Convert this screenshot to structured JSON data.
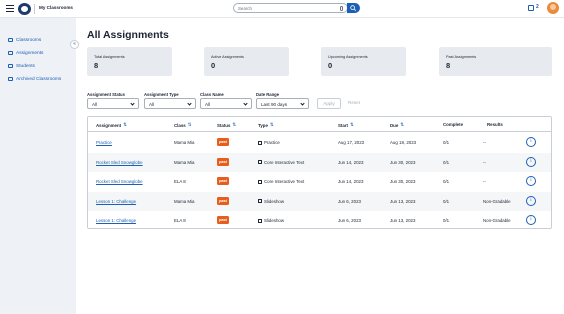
{
  "topbar": {
    "app_title": "My Classrooms",
    "search_placeholder": "Search",
    "notification_count": "2"
  },
  "sidebar": {
    "collapse_glyph": "«",
    "items": [
      {
        "label": "Classrooms"
      },
      {
        "label": "Assignments"
      },
      {
        "label": "Students"
      },
      {
        "label": "Archived Classrooms"
      }
    ]
  },
  "main": {
    "title": "All Assignments",
    "stats": [
      {
        "label": "Total Assignments",
        "value": "8"
      },
      {
        "label": "Active Assignments",
        "value": "0"
      },
      {
        "label": "Upcoming Assignments",
        "value": "0"
      },
      {
        "label": "Past Assignments",
        "value": "8"
      }
    ],
    "filters": {
      "status": {
        "label": "Assignment Status",
        "value": "All"
      },
      "type": {
        "label": "Assignment Type",
        "value": "All"
      },
      "class": {
        "label": "Class Name",
        "value": "All"
      },
      "date": {
        "label": "Date Range",
        "value": "Last 90 days"
      },
      "apply_label": "Apply",
      "reset_label": "Reset"
    },
    "table": {
      "headers": {
        "assignment": "Assignment",
        "class": "Class",
        "status": "Status",
        "type": "Type",
        "start": "Start",
        "due": "Due",
        "complete": "Complete",
        "results": "Results"
      },
      "sort_glyph": "⇅",
      "info_glyph": "i",
      "rows": [
        {
          "assignment": "Practice",
          "class": "Mama Mia",
          "status": "past",
          "type": "Practice",
          "start": "Aug 17, 2023",
          "due": "Aug 18, 2023",
          "complete": "0/1",
          "results": "--"
        },
        {
          "assignment": "Rocket Sled Snowglobe",
          "class": "Mama Mia",
          "status": "past",
          "type": "Core Interactive Text",
          "start": "Jun 14, 2023",
          "due": "Jun 30, 2023",
          "complete": "0/1",
          "results": "--"
        },
        {
          "assignment": "Rocket Sled Snowglobe",
          "class": "ELA 8",
          "status": "past",
          "type": "Core Interactive Text",
          "start": "Jun 14, 2023",
          "due": "Jun 30, 2023",
          "complete": "0/1",
          "results": "--"
        },
        {
          "assignment": "Lesson 1: Challenge",
          "class": "Mama Mia",
          "status": "past",
          "type": "Slideshow",
          "start": "Jun 6, 2023",
          "due": "Jun 13, 2023",
          "complete": "0/1",
          "results": "Non-Gradable"
        },
        {
          "assignment": "Lesson 1: Challenge",
          "class": "ELA 8",
          "status": "past",
          "type": "Slideshow",
          "start": "Jun 6, 2023",
          "due": "Jun 13, 2023",
          "complete": "0/1",
          "results": "Non-Gradable"
        }
      ]
    }
  },
  "colors": {
    "accent": "#1d5fb4",
    "badge_past": "#e85d1c",
    "sidebar_bg": "#eef2f7",
    "stat_bg": "#e7ebef"
  }
}
